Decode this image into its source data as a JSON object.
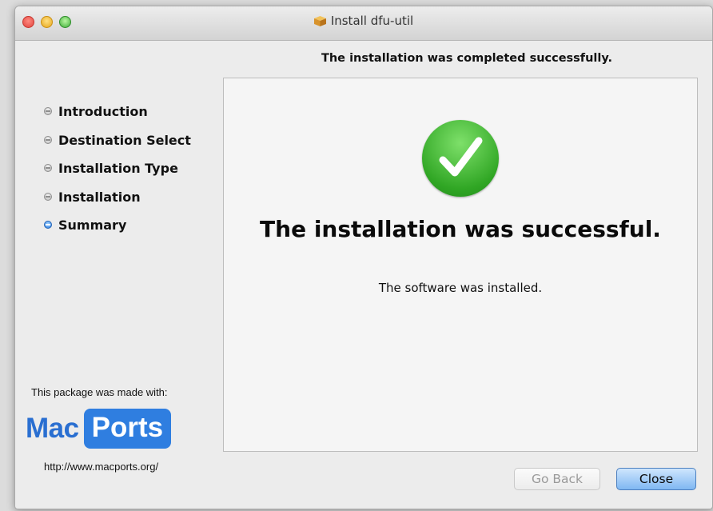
{
  "window": {
    "title": "Install dfu-util",
    "title_icon": "package-icon",
    "heading": "The installation was completed successfully."
  },
  "sidebar": {
    "steps": [
      {
        "label": "Introduction",
        "state": "done"
      },
      {
        "label": "Destination Select",
        "state": "done"
      },
      {
        "label": "Installation Type",
        "state": "done"
      },
      {
        "label": "Installation",
        "state": "done"
      },
      {
        "label": "Summary",
        "state": "active"
      }
    ],
    "made_with": "This package was made with:",
    "logo": {
      "mac": "Mac",
      "ports": "Ports"
    },
    "url": "http://www.macports.org/"
  },
  "main": {
    "icon": "checkmark-icon",
    "title": "The installation was successful.",
    "message": "The software was installed."
  },
  "buttons": {
    "back": "Go Back",
    "close": "Close"
  },
  "colors": {
    "accent": "#2f7ee0",
    "success": "#30a624"
  }
}
